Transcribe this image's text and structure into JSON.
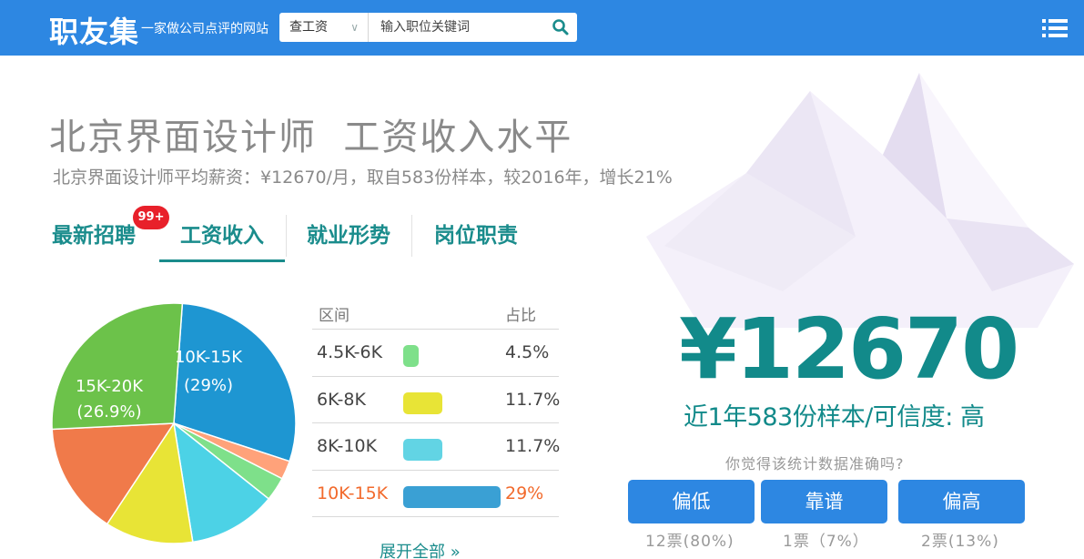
{
  "header": {
    "logo": "职友集",
    "slogan": "一家做公司点评的网站",
    "search_type": "查工资",
    "search_placeholder": "输入职位关键词",
    "search_icon": "search-icon",
    "menu_icon": "list-menu-icon",
    "bg_color": "#2d87e2"
  },
  "page": {
    "title": "北京界面设计师  工资收入水平",
    "subtitle": "北京界面设计师平均薪资：¥12670/月，取自583份样本，较2016年，增长21%"
  },
  "tabs": [
    {
      "label": "最新招聘",
      "badge": "99+"
    },
    {
      "label": "工资收入",
      "active": true
    },
    {
      "label": "就业形势"
    },
    {
      "label": "岗位职责"
    }
  ],
  "chart_data": {
    "type": "pie",
    "slices": [
      {
        "label": "10K-15K",
        "value": 29,
        "color": "#1e96d2"
      },
      {
        "label": "",
        "value": 2.5,
        "color": "#ffa27a"
      },
      {
        "label": "",
        "value": 3.2,
        "color": "#7ee08a"
      },
      {
        "label": "",
        "value": 11.7,
        "color": "#4cd2e6"
      },
      {
        "label": "",
        "value": 11.7,
        "color": "#e8e436"
      },
      {
        "label": "",
        "value": 15.0,
        "color": "#f07a4a"
      },
      {
        "label": "15K-20K",
        "value": 26.9,
        "color": "#6cc24a"
      }
    ],
    "slice_labels": [
      {
        "name": "10K-15K",
        "pct": "(29%)"
      },
      {
        "name": "15K-20K",
        "pct": "(26.9%)"
      }
    ]
  },
  "distribution": {
    "col_range": "区间",
    "col_pct": "占比",
    "rows": [
      {
        "range": "4.5K-6K",
        "pct": "4.5%",
        "value": 4.5,
        "color": "#7ee08a"
      },
      {
        "range": "6K-8K",
        "pct": "11.7%",
        "value": 11.7,
        "color": "#e8e436"
      },
      {
        "range": "8K-10K",
        "pct": "11.7%",
        "value": 11.7,
        "color": "#62d4e4"
      },
      {
        "range": "10K-15K",
        "pct": "29%",
        "value": 29,
        "color": "#3aa0d4",
        "highlight": true
      }
    ],
    "expand": "展开全部 »"
  },
  "summary": {
    "amount": "¥12670",
    "confidence": "近1年583份样本/可信度: 高",
    "question": "你觉得该统计数据准确吗?",
    "votes": [
      {
        "label": "偏低",
        "count": "12票(80%)"
      },
      {
        "label": "靠谱",
        "count": "1票（7%）"
      },
      {
        "label": "偏高",
        "count": "2票(13%)"
      }
    ]
  }
}
